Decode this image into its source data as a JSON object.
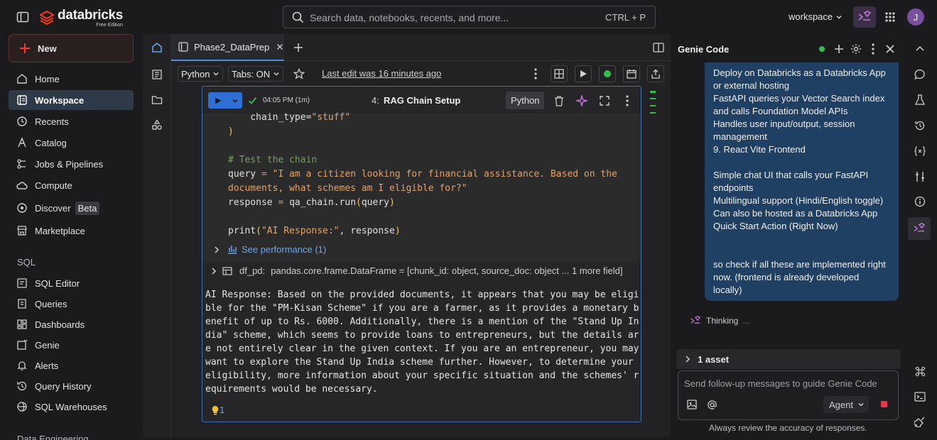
{
  "brand": {
    "name": "databricks",
    "edition": "Free Edition",
    "color": "#ff3621"
  },
  "search": {
    "placeholder": "Search data, notebooks, recents, and more...",
    "shortcut": "CTRL + P"
  },
  "workspace": {
    "label": "workspace"
  },
  "user": {
    "initial": "J",
    "avatar_color": "#7b4fa0"
  },
  "sidebar": {
    "new_label": "New",
    "items": [
      {
        "label": "Home",
        "icon": "home-icon"
      },
      {
        "label": "Workspace",
        "icon": "workspace-icon",
        "active": true
      },
      {
        "label": "Recents",
        "icon": "clock-icon"
      },
      {
        "label": "Catalog",
        "icon": "catalog-icon"
      },
      {
        "label": "Jobs & Pipelines",
        "icon": "jobs-icon"
      },
      {
        "label": "Compute",
        "icon": "cloud-icon"
      },
      {
        "label": "Discover",
        "icon": "compass-icon",
        "badge": "Beta"
      },
      {
        "label": "Marketplace",
        "icon": "store-icon"
      }
    ],
    "sql_section": "SQL",
    "sql_items": [
      {
        "label": "SQL Editor"
      },
      {
        "label": "Queries"
      },
      {
        "label": "Dashboards"
      },
      {
        "label": "Genie"
      },
      {
        "label": "Alerts"
      },
      {
        "label": "Query History"
      },
      {
        "label": "SQL Warehouses"
      }
    ],
    "data_eng_section": "Data Engineering"
  },
  "notebook": {
    "tab_title": "Phase2_DataPrep",
    "language": "Python",
    "tabs_setting": "Tabs: ON",
    "last_edit": "Last edit was 16 minutes ago",
    "cell": {
      "run_time": "04:05 PM (1m)",
      "number": "4:",
      "title": "RAG Chain Setup",
      "lang_badge": "Python",
      "see_performance": "See performance (1)",
      "df_name": "df_pd:",
      "df_type": "pandas.core.frame.DataFrame = [chunk_id: object, source_doc: object ... 1 more field]",
      "output": "AI Response: Based on the provided documents, it appears that you may be eligible for the \"PM-Kisan Scheme\" if you are a farmer, as it provides a monetary benefit of up to Rs. 6000. Additionally, there is a mention of the \"Stand Up India\" scheme, which seems to provide loans to entrepreneurs, but the details are not entirely clear in the given context. If you are an entrepreneur, you may want to explore the Stand Up India scheme further. However, to determine your eligibility, more information about your specific situation and the schemes' requirements would be necessary.",
      "hint_count": "1"
    },
    "code": {
      "l1a": "    chain_type=",
      "l1b": "\"stuff\"",
      "l2": ")",
      "l3": "# Test the chain",
      "l4a": "query ",
      "l4b": "= ",
      "l4c": "\"I am a citizen looking for financial assistance. Based on the",
      "l5": "documents, what schemes am I eligible for?\"",
      "l6a": "response ",
      "l6b": "= ",
      "l6c": "qa_chain.run",
      "l6d": "(",
      "l6e": "query",
      "l6f": ")",
      "l7a": "print",
      "l7b": "(",
      "l7c": "\"AI Response:\"",
      "l7d": ", response",
      "l7e": ")"
    }
  },
  "genie": {
    "title": "Genie Code",
    "message": "Deploy on Databricks as a Databricks App or external hosting\nFastAPI queries your Vector Search index and calls Foundation Model APIs\nHandles user input/output, session management\n9. React Vite Frontend\n\nSimple chat UI that calls your FastAPI endpoints\nMultilingual support (Hindi/English toggle)\nCan also be hosted as a Databricks App\nQuick Start Action (Right Now)\n\n\nso check if all these are implemented right now. (frontend is already developed locally)",
    "thinking": "Thinking",
    "thinking_dots": "...",
    "asset_label": "1 asset",
    "input_placeholder": "Send follow-up messages to guide Genie Code",
    "mode": "Agent",
    "footer": "Always review the accuracy of responses."
  }
}
